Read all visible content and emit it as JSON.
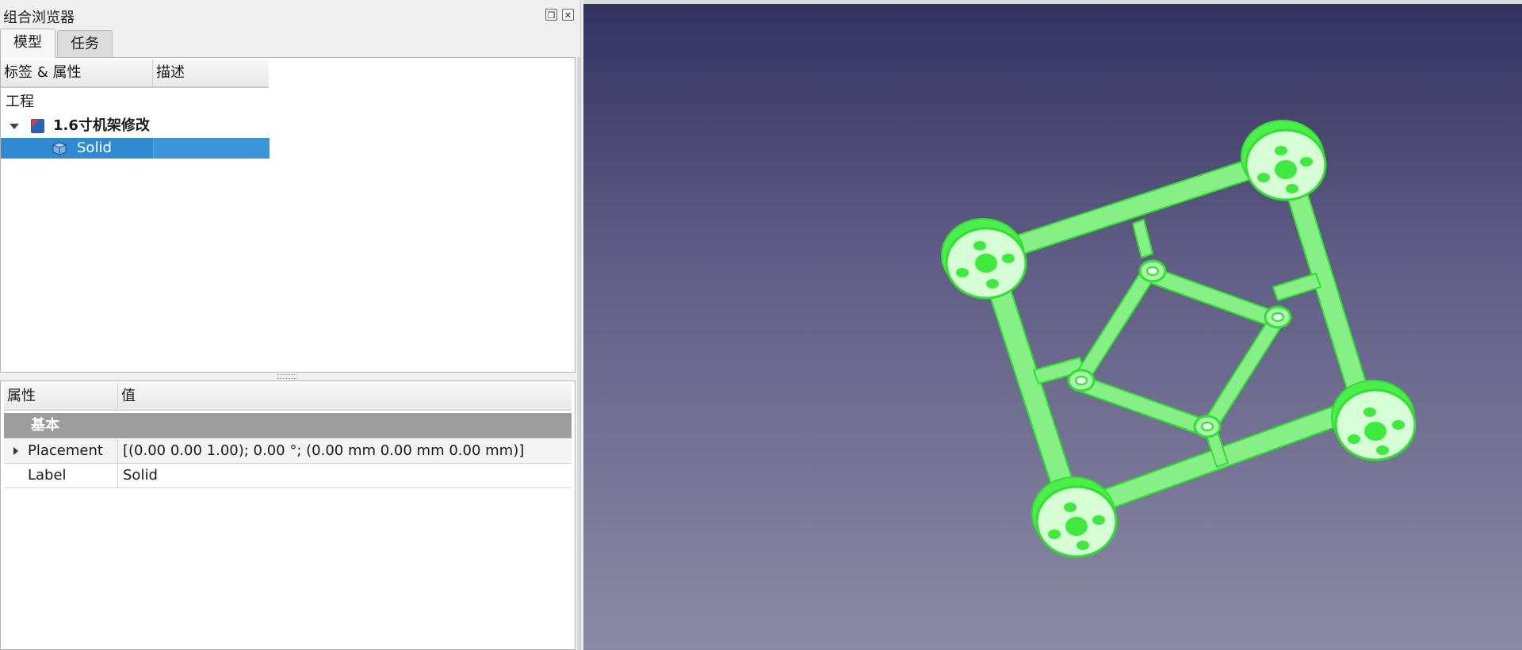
{
  "panel": {
    "title": "组合浏览器",
    "float_button_icon": "float-icon",
    "close_button_icon": "close-icon"
  },
  "tabs": [
    {
      "label": "模型",
      "active": true
    },
    {
      "label": "任务",
      "active": false
    }
  ],
  "tree": {
    "columns": [
      "标签 & 属性",
      "描述"
    ],
    "root_label": "工程",
    "document": {
      "label": "1.6寸机架修改",
      "icon": "freecad-document-icon",
      "expanded": true
    },
    "items": [
      {
        "label": "Solid",
        "icon": "solid-cube-icon",
        "selected": true
      }
    ]
  },
  "properties": {
    "columns": [
      "属性",
      "值"
    ],
    "group": "基本",
    "rows": [
      {
        "name": "Placement",
        "value": "[(0.00 0.00 1.00); 0.00 °; (0.00 mm  0.00 mm  0.00 mm)]",
        "expandable": true
      },
      {
        "name": "Label",
        "value": "Solid",
        "expandable": false
      }
    ]
  },
  "viewport": {
    "background_top": "#33315e",
    "background_bottom": "#8b8aa4",
    "model_color": "#5cf25c",
    "model": "quadcopter-frame"
  },
  "colors": {
    "selection": "#2f8ad1",
    "group_header": "#9d9d9d"
  }
}
